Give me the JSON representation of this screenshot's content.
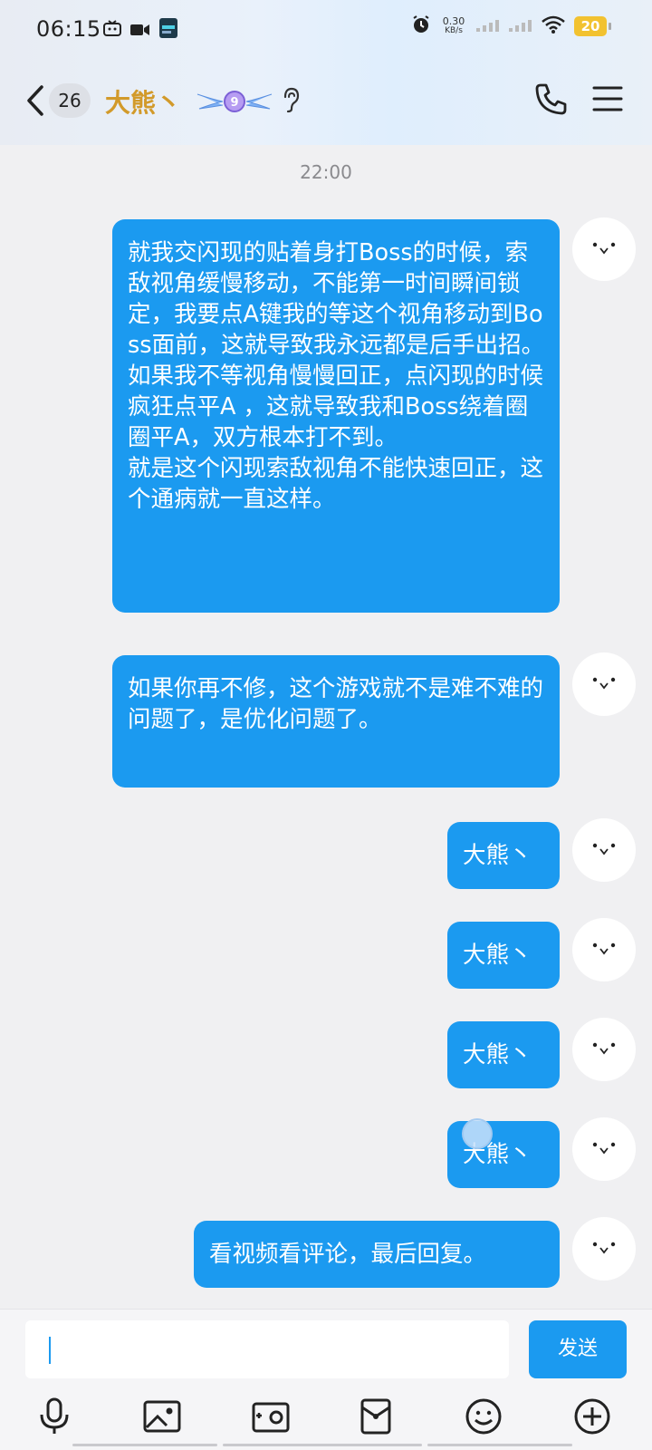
{
  "status_bar": {
    "time": "06:15",
    "net_speed_value": "0.30",
    "net_speed_unit": "KB/s",
    "battery": "20"
  },
  "header": {
    "unread_count": "26",
    "contact_name": "大熊丶",
    "vip_level": "9"
  },
  "chat": {
    "timestamp": "22:00",
    "messages": [
      {
        "text": "就我交闪现的贴着身打Boss的时候，索敌视角缓慢移动，不能第一时间瞬间锁定，我要点A键我的等这个视角移动到Boss面前，这就导致我永远都是后手出招。\n如果我不等视角慢慢回正，点闪现的时候疯狂点平A ，这就导致我和Boss绕着圈圈平A，双方根本打不到。\n就是这个闪现索敌视角不能快速回正，这个通病就一直这样。"
      },
      {
        "text": "如果你再不修，这个游戏就不是难不难的问题了，是优化问题了。"
      },
      {
        "text": "大熊丶"
      },
      {
        "text": "大熊丶"
      },
      {
        "text": "大熊丶"
      },
      {
        "text": "大熊丶"
      },
      {
        "text": "看视频看评论，最后回复。"
      }
    ]
  },
  "input": {
    "value": "",
    "send_label": "发送"
  },
  "toolbar": {
    "items": [
      "microphone-icon",
      "image-icon",
      "camera-icon",
      "red-packet-icon",
      "emoji-icon",
      "plus-icon"
    ]
  },
  "colors": {
    "bubble": "#1b9af0",
    "name": "#d29a2a",
    "background": "#f0f0f2"
  }
}
